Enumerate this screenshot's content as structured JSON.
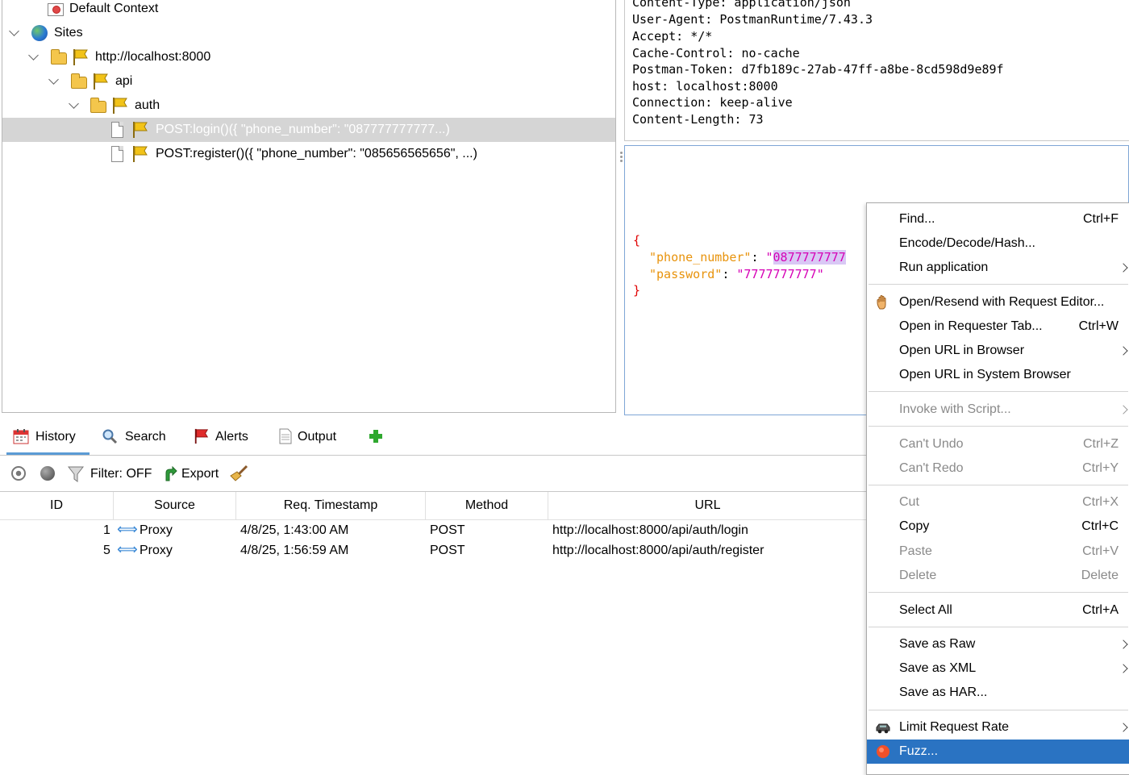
{
  "tree": {
    "default_context": "Default Context",
    "sites": "Sites",
    "host": "http://localhost:8000",
    "api": "api",
    "auth": "auth",
    "login_node": "POST:login()({  \"phone_number\": \"087777777777...)",
    "register_node": "POST:register()({  \"phone_number\": \"085656565656\",  ...)"
  },
  "headers": [
    "Content-Type: application/json",
    "User-Agent: PostmanRuntime/7.43.3",
    "Accept: */*",
    "Cache-Control: no-cache",
    "Postman-Token: d7fb189c-27ab-47ff-a8be-8cd598d9e89f",
    "host: localhost:8000",
    "Connection: keep-alive",
    "Content-Length: 73"
  ],
  "body": {
    "open_brace": "{",
    "key1": "\"phone_number\"",
    "colon1": ": ",
    "quote1": "\"",
    "val1_selected": "0877777777",
    "key2": "\"password\"",
    "colon2": ": ",
    "val2": "\"7777777777\"",
    "close_brace": "}"
  },
  "tabs": {
    "history": "History",
    "search": "Search",
    "alerts": "Alerts",
    "output": "Output"
  },
  "toolbar": {
    "filter": "Filter: OFF",
    "export": "Export"
  },
  "table": {
    "columns": [
      "ID",
      "Source",
      "Req. Timestamp",
      "Method",
      "URL"
    ],
    "rows": [
      {
        "id": "1",
        "source": "Proxy",
        "timestamp": "4/8/25, 1:43:00 AM",
        "method": "POST",
        "url": "http://localhost:8000/api/auth/login"
      },
      {
        "id": "5",
        "source": "Proxy",
        "timestamp": "4/8/25, 1:56:59 AM",
        "method": "POST",
        "url": "http://localhost:8000/api/auth/register"
      }
    ]
  },
  "menu": {
    "find": "Find...",
    "find_sc": "Ctrl+F",
    "encode": "Encode/Decode/Hash...",
    "run_app": "Run application",
    "open_resend": "Open/Resend with Request Editor...",
    "open_requester": "Open in Requester Tab...",
    "open_requester_sc": "Ctrl+W",
    "open_url_browser": "Open URL in Browser",
    "open_url_system": "Open URL in System Browser",
    "invoke_script": "Invoke with Script...",
    "cant_undo": "Can't Undo",
    "cant_undo_sc": "Ctrl+Z",
    "cant_redo": "Can't Redo",
    "cant_redo_sc": "Ctrl+Y",
    "cut": "Cut",
    "cut_sc": "Ctrl+X",
    "copy": "Copy",
    "copy_sc": "Ctrl+C",
    "paste": "Paste",
    "paste_sc": "Ctrl+V",
    "delete": "Delete",
    "delete_sc": "Delete",
    "select_all": "Select All",
    "select_all_sc": "Ctrl+A",
    "save_raw": "Save as Raw",
    "save_xml": "Save as XML",
    "save_har": "Save as HAR...",
    "limit_rate": "Limit Request Rate",
    "fuzz": "Fuzz..."
  },
  "colors": {
    "menu_highlight": "#2a73c2",
    "json_brace": "#e00000",
    "json_key": "#e8930c",
    "json_value": "#d600b6",
    "text_selection": "#d9c8f5"
  }
}
